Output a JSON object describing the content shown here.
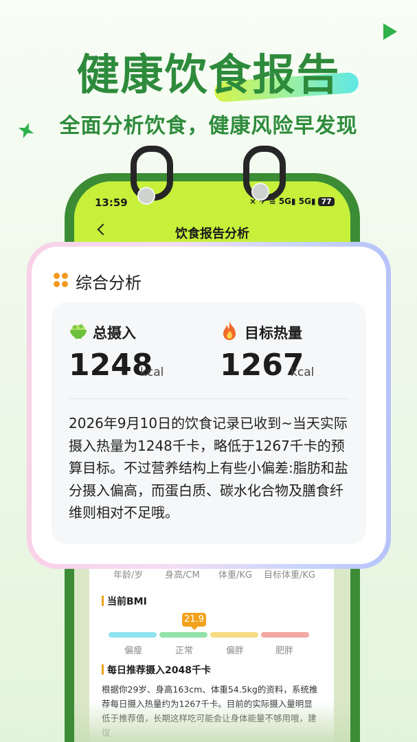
{
  "header": {
    "title": "健康饮食报告",
    "subtitle": "全面分析饮食，健康风险早发现"
  },
  "icons": {
    "play": "play-icon",
    "sparkle": "sparkle-icon",
    "back": "chevron-left-icon",
    "section": "four-dot-icon",
    "bowl": "bowl-icon",
    "fire": "fire-icon"
  },
  "phone": {
    "status_time": "13:59",
    "status_icons": "⨯ ✈ ≋ 5G▮ 5G▮",
    "battery": "77",
    "nav_title": "饮食报告分析"
  },
  "card": {
    "title": "综合分析",
    "intake_label": "总摄入",
    "intake_value": "1248",
    "intake_unit": "kcal",
    "target_label": "目标热量",
    "target_value": "1267",
    "target_unit": "kcal",
    "summary": "2026年9月10日的饮食记录已收到~当天实际摄入热量为1248千卡，略低于1267千卡的预算目标。不过营养结构上有些小偏差:脂肪和盐分摄入偏高，而蛋白质、碳水化合物及膳食纤维则相对不足哦。"
  },
  "metrics": {
    "age": "年龄/岁",
    "height": "身高/CM",
    "weight": "体重/KG",
    "target_weight": "目标体重/KG"
  },
  "bmi": {
    "title": "当前BMI",
    "value": "21.9",
    "ranges": [
      "偏瘦",
      "正常",
      "偏胖",
      "肥胖"
    ]
  },
  "recommend": {
    "title": "每日推荐摄入2048千卡",
    "text": "根据你29岁、身高163cm、体重54.5kg的资料，系统推荐每日摄入热量约为1267千卡。目前的实际摄入量明显低于推荐值，长期这样吃可能会让身体能量不够用哦，建议"
  },
  "colors": {
    "brand_green": "#2e8b3c",
    "screen_lime": "#c6f03a",
    "accent_orange": "#f39a1f",
    "bmi_thin": "#8ee3ee",
    "bmi_normal": "#93e2a8",
    "bmi_over": "#f6dc84",
    "bmi_obese": "#f3a8a4"
  }
}
